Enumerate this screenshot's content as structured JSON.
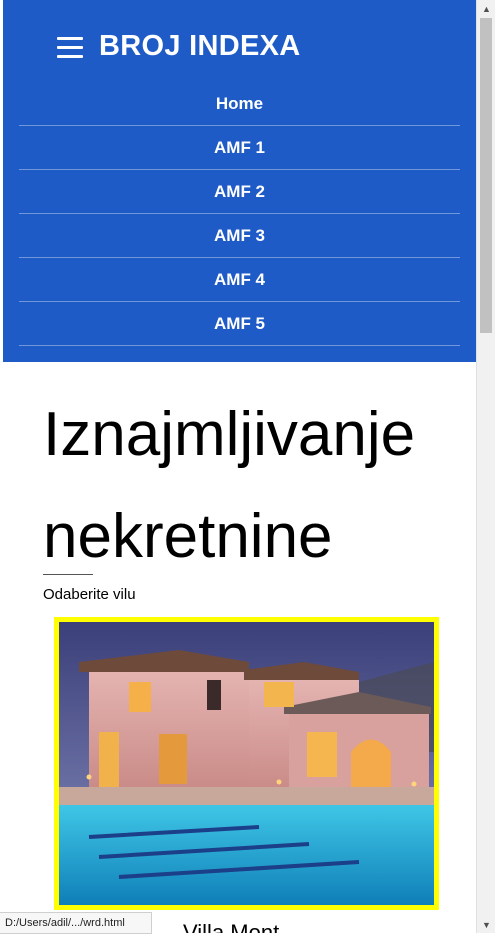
{
  "navbar": {
    "brand": "BROJ INDEXA",
    "menu_items": [
      "Home",
      "AMF 1",
      "AMF 2",
      "AMF 3",
      "AMF 4",
      "AMF 5"
    ],
    "background": "#1e5bc6"
  },
  "main": {
    "heading": "Iznajmljivanje nekretnine",
    "subtitle": "Odaberite vilu",
    "villa_title": "Villa Mont",
    "frame_color": "#ffff00"
  },
  "status_bar": {
    "url": "D:/Users/adil/.../wrd.html"
  },
  "icons": [
    "menu-hamburger-icon",
    "scroll-up-arrow-icon",
    "scroll-down-arrow-icon"
  ]
}
